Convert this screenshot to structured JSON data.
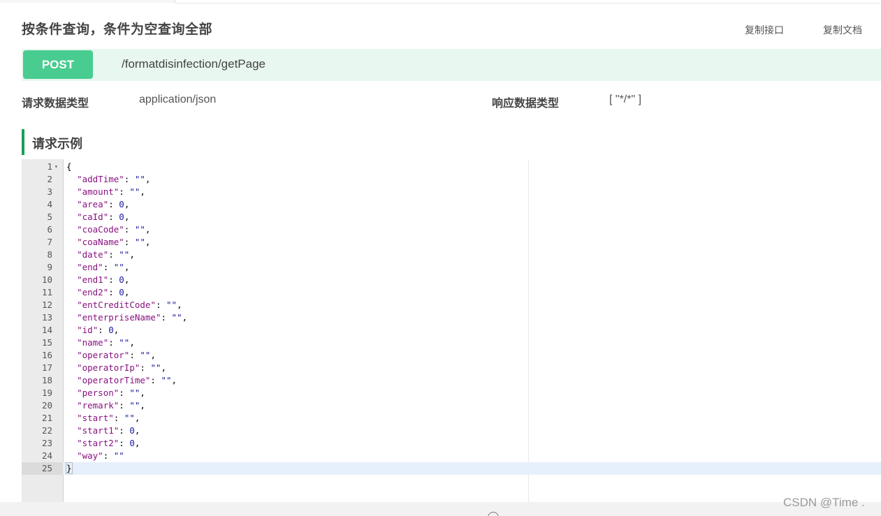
{
  "header": {
    "title": "按条件查询，条件为空查询全部",
    "copy_api_label": "复制接口",
    "copy_doc_label": "复制文档"
  },
  "endpoint": {
    "method": "POST",
    "path": "/formatdisinfection/getPage",
    "method_color": "#49cc90"
  },
  "meta": {
    "request_type_label": "请求数据类型",
    "request_type_value": "application/json",
    "response_type_label": "响应数据类型",
    "response_type_value": "[ \"*/*\" ]"
  },
  "section": {
    "title": "请求示例",
    "accent_color": "#18a058"
  },
  "editor": {
    "active_line": 25,
    "lines": [
      {
        "n": "1",
        "code": "{"
      },
      {
        "n": "2",
        "key": "\"addTime\"",
        "val": "\"\"",
        "type": "str",
        "comma": true
      },
      {
        "n": "3",
        "key": "\"amount\"",
        "val": "\"\"",
        "type": "str",
        "comma": true
      },
      {
        "n": "4",
        "key": "\"area\"",
        "val": "0",
        "type": "num",
        "comma": true
      },
      {
        "n": "5",
        "key": "\"caId\"",
        "val": "0",
        "type": "num",
        "comma": true
      },
      {
        "n": "6",
        "key": "\"coaCode\"",
        "val": "\"\"",
        "type": "str",
        "comma": true
      },
      {
        "n": "7",
        "key": "\"coaName\"",
        "val": "\"\"",
        "type": "str",
        "comma": true
      },
      {
        "n": "8",
        "key": "\"date\"",
        "val": "\"\"",
        "type": "str",
        "comma": true
      },
      {
        "n": "9",
        "key": "\"end\"",
        "val": "\"\"",
        "type": "str",
        "comma": true
      },
      {
        "n": "10",
        "key": "\"end1\"",
        "val": "0",
        "type": "num",
        "comma": true
      },
      {
        "n": "11",
        "key": "\"end2\"",
        "val": "0",
        "type": "num",
        "comma": true
      },
      {
        "n": "12",
        "key": "\"entCreditCode\"",
        "val": "\"\"",
        "type": "str",
        "comma": true
      },
      {
        "n": "13",
        "key": "\"enterpriseName\"",
        "val": "\"\"",
        "type": "str",
        "comma": true
      },
      {
        "n": "14",
        "key": "\"id\"",
        "val": "0",
        "type": "num",
        "comma": true
      },
      {
        "n": "15",
        "key": "\"name\"",
        "val": "\"\"",
        "type": "str",
        "comma": true
      },
      {
        "n": "16",
        "key": "\"operator\"",
        "val": "\"\"",
        "type": "str",
        "comma": true
      },
      {
        "n": "17",
        "key": "\"operatorIp\"",
        "val": "\"\"",
        "type": "str",
        "comma": true
      },
      {
        "n": "18",
        "key": "\"operatorTime\"",
        "val": "\"\"",
        "type": "str",
        "comma": true
      },
      {
        "n": "19",
        "key": "\"person\"",
        "val": "\"\"",
        "type": "str",
        "comma": true
      },
      {
        "n": "20",
        "key": "\"remark\"",
        "val": "\"\"",
        "type": "str",
        "comma": true
      },
      {
        "n": "21",
        "key": "\"start\"",
        "val": "\"\"",
        "type": "str",
        "comma": true
      },
      {
        "n": "22",
        "key": "\"start1\"",
        "val": "0",
        "type": "num",
        "comma": true
      },
      {
        "n": "23",
        "key": "\"start2\"",
        "val": "0",
        "type": "num",
        "comma": true
      },
      {
        "n": "24",
        "key": "\"way\"",
        "val": "\"\"",
        "type": "str",
        "comma": false
      },
      {
        "n": "25",
        "code": "}"
      }
    ]
  },
  "watermark": "CSDN @Time ."
}
